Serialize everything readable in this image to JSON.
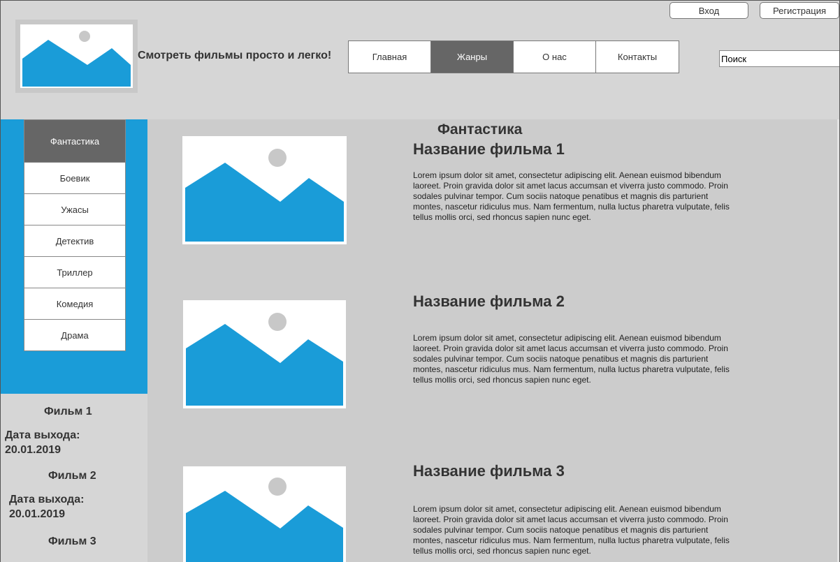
{
  "header": {
    "login_label": "Вход",
    "register_label": "Регистрация",
    "tagline": "Смотреть фильмы просто и легко!",
    "search_placeholder": "Поиск",
    "nav": [
      {
        "label": "Главная",
        "active": false
      },
      {
        "label": "Жанры",
        "active": true
      },
      {
        "label": "О нас",
        "active": false
      },
      {
        "label": "Контакты",
        "active": false
      }
    ]
  },
  "sidebar": {
    "genres": [
      {
        "label": "Фантастика",
        "active": true
      },
      {
        "label": "Боевик",
        "active": false
      },
      {
        "label": "Ужасы",
        "active": false
      },
      {
        "label": "Детектив",
        "active": false
      },
      {
        "label": "Триллер",
        "active": false
      },
      {
        "label": "Комедия",
        "active": false
      },
      {
        "label": "Драма",
        "active": false
      }
    ],
    "films": [
      {
        "title": "Фильм 1",
        "date_label": "Дата выхода:",
        "date": "20.01.2019"
      },
      {
        "title": "Фильм 2",
        "date_label": "Дата выхода:",
        "date": "20.01.2019"
      },
      {
        "title": "Фильм 3"
      }
    ]
  },
  "main": {
    "section_title": "Фантастика",
    "movies": [
      {
        "title": "Название фильма 1",
        "description": "Lorem ipsum dolor sit amet, consectetur adipiscing elit. Aenean euismod bibendum laoreet. Proin gravida dolor sit amet lacus accumsan et viverra justo commodo. Proin sodales pulvinar tempor. Cum sociis natoque penatibus et magnis dis parturient montes, nascetur ridiculus mus. Nam fermentum, nulla luctus pharetra vulputate, felis tellus mollis orci, sed rhoncus sapien nunc eget."
      },
      {
        "title": "Название фильма 2",
        "description": "Lorem ipsum dolor sit amet, consectetur adipiscing elit. Aenean euismod bibendum laoreet. Proin gravida dolor sit amet lacus accumsan et viverra justo commodo. Proin sodales pulvinar tempor. Cum sociis natoque penatibus et magnis dis parturient montes, nascetur ridiculus mus. Nam fermentum, nulla luctus pharetra vulputate, felis tellus mollis orci, sed rhoncus sapien nunc eget."
      },
      {
        "title": "Название фильма 3",
        "description": "Lorem ipsum dolor sit amet, consectetur adipiscing elit. Aenean euismod bibendum laoreet. Proin gravida dolor sit amet lacus accumsan et viverra justo commodo. Proin sodales pulvinar tempor. Cum sociis natoque penatibus et magnis dis parturient montes, nascetur ridiculus mus. Nam fermentum, nulla luctus pharetra vulputate, felis tellus mollis orci, sed rhoncus sapien nunc eget."
      }
    ]
  },
  "colors": {
    "accent": "#1a9cd8",
    "active_tab": "#666666",
    "placeholder_sun": "#c8c8c8"
  },
  "icons": {
    "logo": "image-placeholder-icon",
    "poster": "image-placeholder-icon"
  }
}
